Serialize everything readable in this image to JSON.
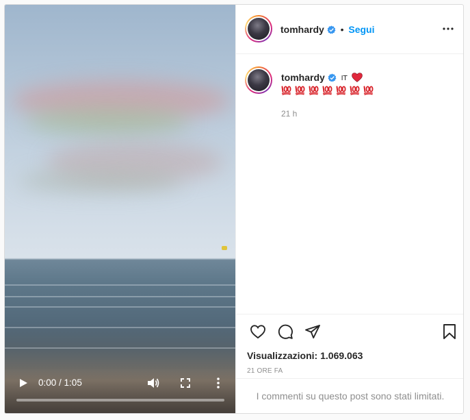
{
  "post": {
    "video": {
      "current_time": "0:00",
      "time_separator": " / ",
      "duration": "1:05",
      "progress": 0.0
    },
    "header": {
      "username": "tomhardy",
      "separator": "•",
      "follow_label": "Segui",
      "more_icon": "more-horizontal-icon"
    },
    "caption": {
      "username": "tomhardy",
      "flag_text": "IT",
      "emoji_count": 7,
      "time_ago": "21 h"
    },
    "actions": {
      "icons": [
        "heart-icon",
        "comment-icon",
        "share-icon",
        "bookmark-icon"
      ],
      "views_label": "Visualizzazioni:",
      "views_count": "1.069.063",
      "date": "21 ORE FA"
    },
    "comments_limited_text": "I commenti su questo post sono stati limitati."
  },
  "colors": {
    "link_blue": "#0095f6",
    "verified_blue": "#3897f0",
    "heart_red": "#ed4956",
    "muted_text": "#8e8e8e"
  }
}
